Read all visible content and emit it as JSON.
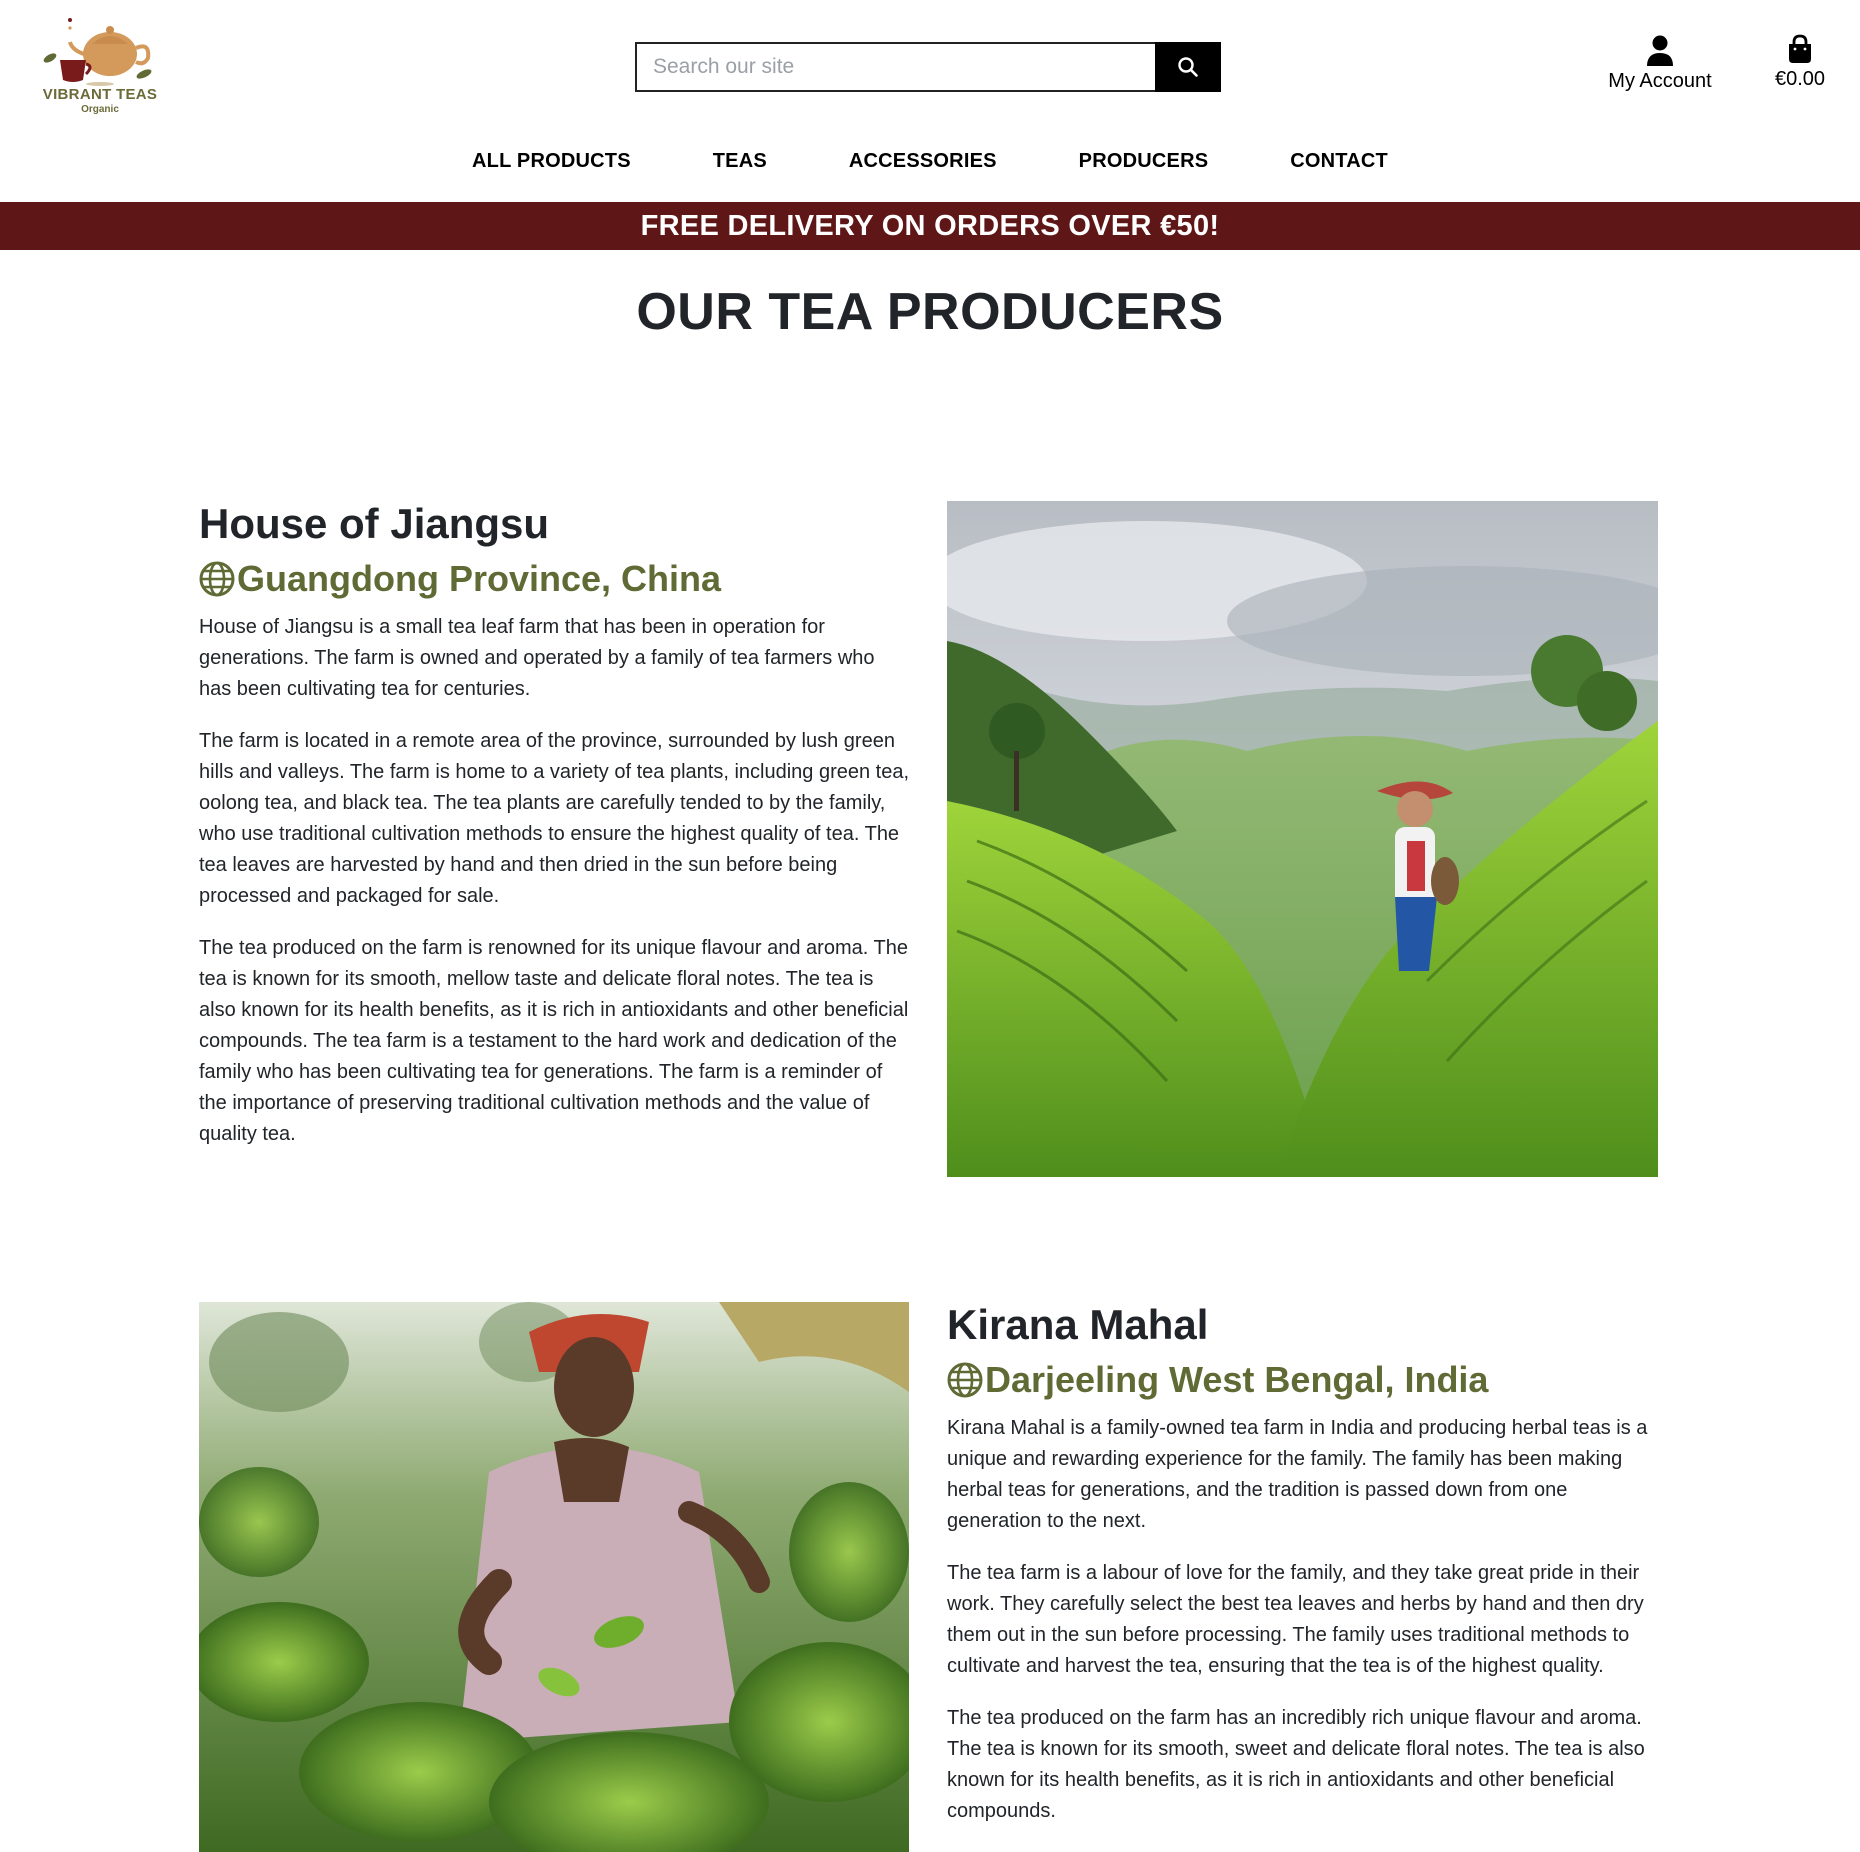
{
  "brand": {
    "name": "VIBRANT TEAS",
    "tagline": "Organic"
  },
  "search": {
    "placeholder": "Search our site",
    "value": ""
  },
  "account": {
    "label": "My Account"
  },
  "cart": {
    "total": "€0.00"
  },
  "nav": {
    "items": [
      {
        "label": "ALL PRODUCTS"
      },
      {
        "label": "TEAS"
      },
      {
        "label": "ACCESSORIES"
      },
      {
        "label": "PRODUCERS"
      },
      {
        "label": "CONTACT"
      }
    ]
  },
  "banner": {
    "text": "FREE DELIVERY ON ORDERS OVER €50!"
  },
  "page": {
    "title": "OUR TEA PRODUCERS"
  },
  "producers": [
    {
      "name": "House of Jiangsu",
      "location": "Guangdong Province, China",
      "paragraphs": [
        "House of Jiangsu is a small tea leaf farm that has been in operation for generations. The farm is owned and operated by a family of tea farmers who has been cultivating tea for centuries.",
        "The farm is located in a remote area of the province, surrounded by lush green hills and valleys. The farm is home to a variety of tea plants, including green tea, oolong tea, and black tea. The tea plants are carefully tended to by the family, who use traditional cultivation methods to ensure the highest quality of tea. The tea leaves are harvested by hand and then dried in the sun before being processed and packaged for sale.",
        "The tea produced on the farm is renowned for its unique flavour and aroma. The tea is known for its smooth, mellow taste and delicate floral notes. The tea is also known for its health benefits, as it is rich in antioxidants and other beneficial compounds. The tea farm is a testament to the hard work and dedication of the family who has been cultivating tea for generations. The farm is a reminder of the importance of preserving traditional cultivation methods and the value of quality tea."
      ]
    },
    {
      "name": "Kirana Mahal",
      "location": "Darjeeling West Bengal, India",
      "paragraphs": [
        "Kirana Mahal is a family-owned tea farm in India and producing herbal teas is a unique and rewarding experience for the family. The family has been making herbal teas for generations, and the tradition is passed down from one generation to the next.",
        "The tea farm is a labour of love for the family, and they take great pride in their work. They carefully select the best tea leaves and herbs by hand and then dry them out in the sun before processing. The family uses traditional methods to cultivate and harvest the tea, ensuring that the tea is of the highest quality.",
        "The tea produced on the farm has an incredibly rich unique flavour and aroma. The tea is known for its smooth, sweet and delicate floral notes. The tea is also known for its health benefits, as it is rich in antioxidants and other beneficial compounds."
      ]
    }
  ],
  "colors": {
    "banner": "#5e1616",
    "location_text": "#5f6a35",
    "search_button": "#000000"
  },
  "icons": [
    "search-icon",
    "account-icon",
    "shopping-bag-icon",
    "globe-icon"
  ]
}
